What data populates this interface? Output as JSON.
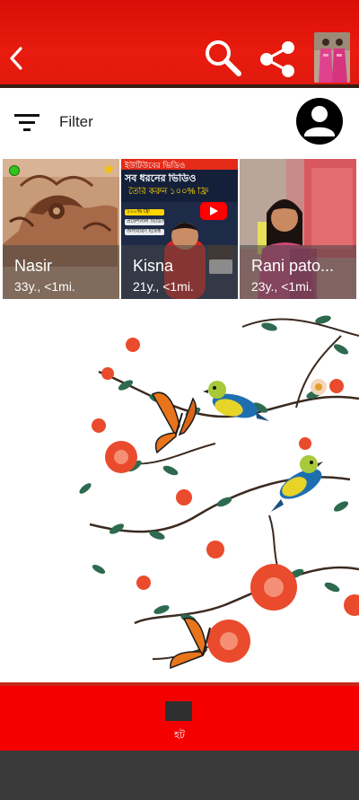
{
  "header": {
    "back_icon": "chevron-left-icon",
    "search_icon": "magnifier-icon",
    "share_icon": "share-icon",
    "avatar": "profile-photo"
  },
  "filter": {
    "label": "Filter",
    "icon": "filter-lines-icon",
    "account_icon": "account-circle-icon"
  },
  "profiles": [
    {
      "name": "Nasir",
      "meta": "33y., <1mi.",
      "online": true,
      "starred": true
    },
    {
      "name": "Kisna",
      "meta": "21y., <1mi.",
      "online": false,
      "starred": false
    },
    {
      "name": "Rani pato...",
      "meta": "23y., <1mi.",
      "online": false,
      "starred": false
    }
  ],
  "tile2_banner": {
    "line1": "ইউটিউবের ভিডিও",
    "line2": "সব ধরনের ভিডিও",
    "line3": "তৈরি করুন ১০০% ফ্রি",
    "bullets": [
      "১০০% ফ্রি",
      "প্রফেশনাল ভিডিও",
      "অসাধারণ ইফেক্ট"
    ]
  },
  "bottom": {
    "home_label": "হট"
  },
  "colors": {
    "appbar": "#e2170a",
    "bottom_bar": "#f40000",
    "nav_bar": "#3a3a3a",
    "online": "#31c41d",
    "star": "#f5c400"
  }
}
